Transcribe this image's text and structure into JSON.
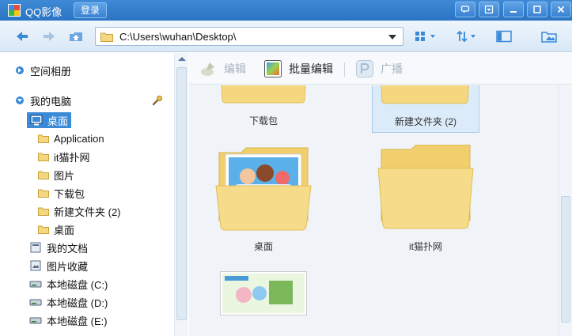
{
  "titlebar": {
    "app_title": "QQ影像",
    "login_label": "登录",
    "icons": [
      "feedback-icon",
      "menu-icon",
      "minimize-icon",
      "maximize-icon",
      "close-icon"
    ]
  },
  "toolbar": {
    "address": "C:\\Users\\wuhan\\Desktop\\",
    "icons": [
      "back-arrow-icon",
      "forward-arrow-icon",
      "up-folder-icon",
      "grid-view-icon",
      "sort-icon",
      "preview-pane-icon",
      "folder-browse-icon"
    ]
  },
  "sidebar": {
    "items": [
      {
        "label": "空间相册",
        "type": "section"
      },
      {
        "label": "我的电脑",
        "type": "section"
      },
      {
        "label": "桌面",
        "type": "selected"
      },
      {
        "label": "Application",
        "type": "folder"
      },
      {
        "label": "it猫扑网",
        "type": "folder"
      },
      {
        "label": "图片",
        "type": "folder"
      },
      {
        "label": "下载包",
        "type": "folder"
      },
      {
        "label": "新建文件夹 (2)",
        "type": "folder"
      },
      {
        "label": "桌面",
        "type": "folder"
      },
      {
        "label": "我的文档",
        "type": "docs"
      },
      {
        "label": "图片收藏",
        "type": "pictures"
      },
      {
        "label": "本地磁盘 (C:)",
        "type": "disk"
      },
      {
        "label": "本地磁盘 (D:)",
        "type": "disk"
      },
      {
        "label": "本地磁盘 (E:)",
        "type": "disk"
      }
    ]
  },
  "actions": {
    "edit_label": "编辑",
    "batch_edit_label": "批量编辑",
    "broadcast_label": "广播"
  },
  "tiles": [
    {
      "label": "下载包",
      "selected": false
    },
    {
      "label": "新建文件夹 (2)",
      "selected": true
    },
    {
      "label": "桌面",
      "selected": false
    },
    {
      "label": "it猫扑网",
      "selected": false
    },
    {
      "label": "",
      "selected": false
    }
  ],
  "colors": {
    "titlebar": "#2f7bcb",
    "selection": "#3a8ad8",
    "folder": "#f4d77e"
  }
}
